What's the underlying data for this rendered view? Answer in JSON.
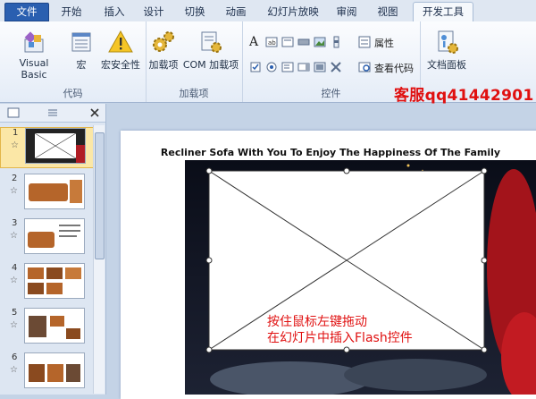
{
  "tabs": [
    "文件",
    "开始",
    "插入",
    "设计",
    "切换",
    "动画",
    "幻灯片放映",
    "审阅",
    "视图",
    "开发工具"
  ],
  "ribbon": {
    "code_group": {
      "label": "代码",
      "buttons": [
        "Visual Basic",
        "宏",
        "宏安全性"
      ]
    },
    "addins_group": {
      "label": "加载项",
      "buttons": [
        "加载项",
        "COM 加载项"
      ]
    },
    "controls_group": {
      "label": "控件",
      "properties": "属性",
      "view_code": "查看代码"
    },
    "modify_group": {
      "button": "文档面板"
    }
  },
  "watermark": "客服qq41442901",
  "thumbnails": [
    "1",
    "2",
    "3",
    "4",
    "5",
    "6"
  ],
  "slide": {
    "title": "Recliner  Sofa  With You To Enjoy The Happiness Of The Family",
    "instruction_line1": "按住鼠标左键拖动",
    "instruction_line2": "在幻灯片中插入Flash控件"
  },
  "colors": {
    "file_tab": "#2a5fb0",
    "instruction_text": "#e01010"
  }
}
